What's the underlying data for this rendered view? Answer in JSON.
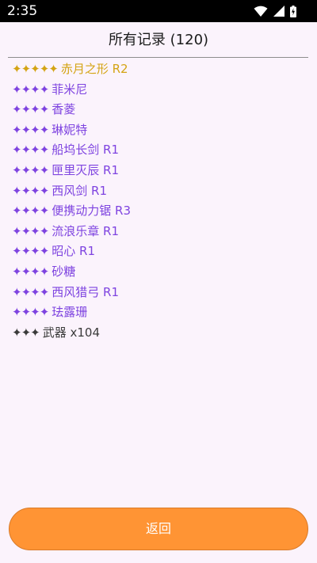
{
  "status_bar": {
    "time": "2:35",
    "icons": [
      "wifi-icon",
      "cell-signal-icon",
      "battery-charging-icon"
    ]
  },
  "header": {
    "title": "所有记录 (120)"
  },
  "records": [
    {
      "stars": "✦✦✦✦✦",
      "label": "赤月之形 R2",
      "rarity": 5
    },
    {
      "stars": "✦✦✦✦",
      "label": "菲米尼",
      "rarity": 4
    },
    {
      "stars": "✦✦✦✦",
      "label": "香菱",
      "rarity": 4
    },
    {
      "stars": "✦✦✦✦",
      "label": "琳妮特",
      "rarity": 4
    },
    {
      "stars": "✦✦✦✦",
      "label": "船坞长剑 R1",
      "rarity": 4
    },
    {
      "stars": "✦✦✦✦",
      "label": "匣里灭辰 R1",
      "rarity": 4
    },
    {
      "stars": "✦✦✦✦",
      "label": "西风剑 R1",
      "rarity": 4
    },
    {
      "stars": "✦✦✦✦",
      "label": "便携动力锯 R3",
      "rarity": 4
    },
    {
      "stars": "✦✦✦✦",
      "label": "流浪乐章 R1",
      "rarity": 4
    },
    {
      "stars": "✦✦✦✦",
      "label": "昭心 R1",
      "rarity": 4
    },
    {
      "stars": "✦✦✦✦",
      "label": "砂糖",
      "rarity": 4
    },
    {
      "stars": "✦✦✦✦",
      "label": "西风猎弓 R1",
      "rarity": 4
    },
    {
      "stars": "✦✦✦✦",
      "label": "珐露珊",
      "rarity": 4
    },
    {
      "stars": "✦✦✦",
      "label": "武器 x104",
      "rarity": 3
    }
  ],
  "colors": {
    "rarity_5": "#d4a414",
    "rarity_4": "#7e43e0",
    "rarity_3": "#3a3a3a",
    "button": "#ff9434",
    "background": "#fbf3fc"
  },
  "footer": {
    "back_label": "返回"
  }
}
